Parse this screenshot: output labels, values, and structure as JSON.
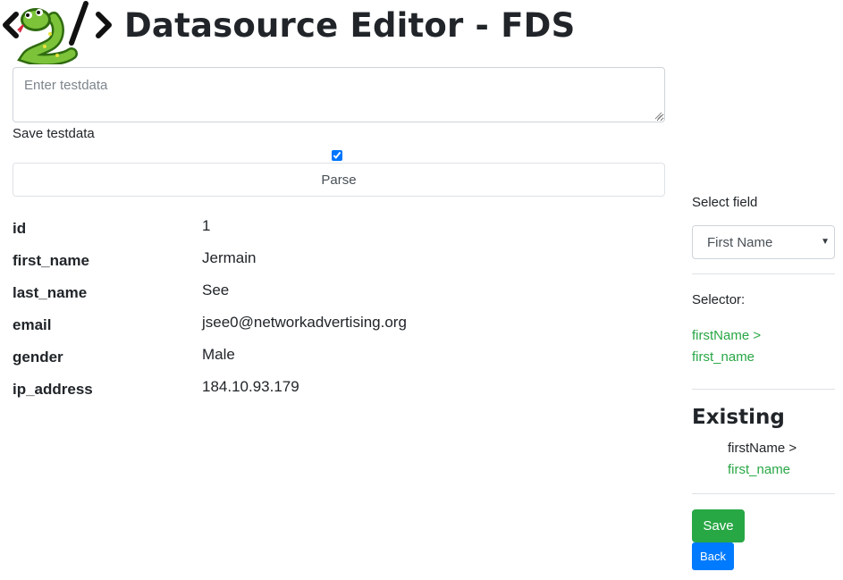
{
  "header": {
    "title": "Datasource Editor - FDS"
  },
  "testdata": {
    "placeholder": "Enter testdata",
    "value": "",
    "save_label": "Save testdata",
    "save_checked": true
  },
  "parse_label": "Parse",
  "fields": [
    {
      "key": "id",
      "value": "1"
    },
    {
      "key": "first_name",
      "value": "Jermain"
    },
    {
      "key": "last_name",
      "value": "See"
    },
    {
      "key": "email",
      "value": "jsee0@networkadvertising.org"
    },
    {
      "key": "gender",
      "value": "Male"
    },
    {
      "key": "ip_address",
      "value": "184.10.93.179"
    }
  ],
  "sidebar": {
    "select_label": "Select field",
    "select_value": "First Name",
    "selector_label": "Selector:",
    "selector_line1": "firstName >",
    "selector_line2": "first_name",
    "existing_title": "Existing",
    "existing_line1": "firstName >",
    "existing_line2": "first_name",
    "save_label": "Save",
    "back_label": "Back"
  },
  "colors": {
    "success": "#28a745",
    "primary": "#007bff",
    "text": "#212529",
    "border": "#ced4da"
  },
  "icons": {
    "logo": "snake-code-logo-icon",
    "resize": "resize-grip-icon",
    "select_caret": "caret-down-icon"
  }
}
